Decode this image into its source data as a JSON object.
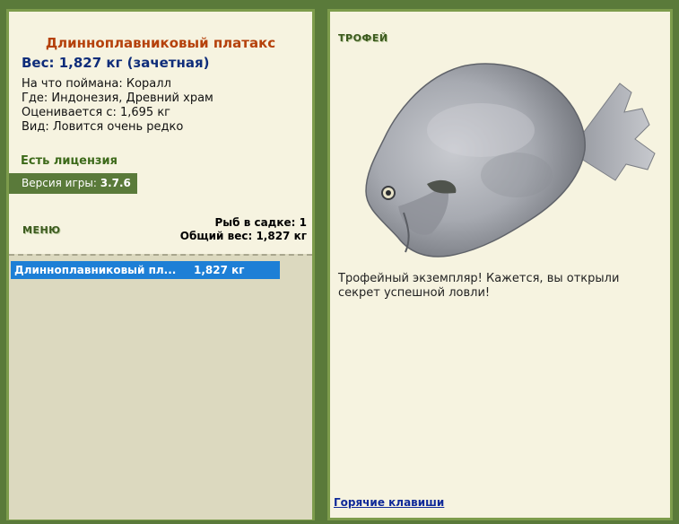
{
  "fish": {
    "title": "Длинноплавниковый платакс",
    "weight": "Вес: 1,827 кг (зачетная)",
    "info": [
      "На что поймана: Коралл",
      "Где: Индонезия, Древний храм",
      "Оценивается с: 1,695 кг",
      "Вид: Ловится очень редко"
    ]
  },
  "license": "Есть лицензия",
  "version": {
    "label": "Версия игры:",
    "value": "3.7.6"
  },
  "menu": "МЕНЮ",
  "stats": {
    "fish_count": "Рыб в садке: 1",
    "total_weight": "Общий вес: 1,827 кг"
  },
  "keepnet": [
    {
      "name": "Длинноплавниковый пл...",
      "weight": "1,827 кг"
    }
  ],
  "trophy": {
    "label": "ТРОФЕЙ",
    "text": "Трофейный экземпляр! Кажется, вы открыли секрет успешной ловли!"
  },
  "hotkeys": "Горячие клавиши"
}
